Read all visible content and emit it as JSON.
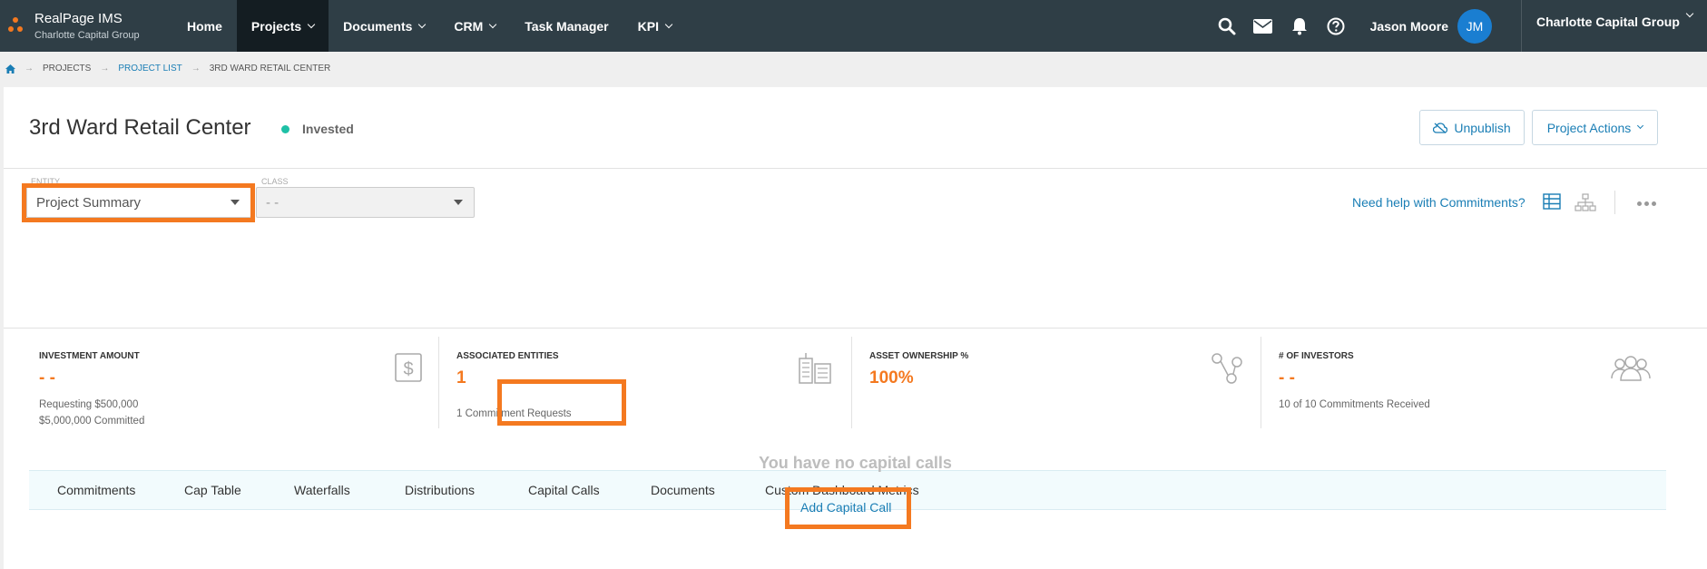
{
  "brand": {
    "title": "RealPage IMS",
    "subtitle": "Charlotte Capital Group"
  },
  "nav": {
    "items": [
      {
        "label": "Home",
        "active": false,
        "dropdown": false
      },
      {
        "label": "Projects",
        "active": true,
        "dropdown": true
      },
      {
        "label": "Documents",
        "active": false,
        "dropdown": true
      },
      {
        "label": "CRM",
        "active": false,
        "dropdown": true
      },
      {
        "label": "Task Manager",
        "active": false,
        "dropdown": false
      },
      {
        "label": "KPI",
        "active": false,
        "dropdown": true
      }
    ],
    "icons": [
      "search-icon",
      "mail-icon",
      "bell-icon",
      "help-icon"
    ],
    "user_name": "Jason Moore",
    "user_initials": "JM",
    "org": "Charlotte Capital Group"
  },
  "breadcrumb": {
    "home_icon": "home-icon",
    "items": [
      "PROJECTS",
      "PROJECT LIST",
      "3RD WARD RETAIL CENTER"
    ]
  },
  "project": {
    "title": "3rd Ward Retail Center",
    "status": "Invested",
    "status_color": "#1ec0a6",
    "unpublish_label": "Unpublish",
    "actions_label": "Project Actions"
  },
  "filters": {
    "entity_label": "ENTITY",
    "entity_value": "Project Summary",
    "class_label": "CLASS",
    "class_value": "- -",
    "help_text": "Need help with Commitments?"
  },
  "stats": [
    {
      "label": "INVESTMENT AMOUNT",
      "value": "- -",
      "notes": [
        "Requesting $500,000",
        "$5,000,000 Committed"
      ],
      "icon": "dollar-icon"
    },
    {
      "label": "ASSOCIATED ENTITIES",
      "value": "1",
      "notes": [
        "1 Commitment Requests"
      ],
      "icon": "buildings-icon"
    },
    {
      "label": "ASSET OWNERSHIP %",
      "value": "100%",
      "notes": [],
      "icon": "share-nodes-icon"
    },
    {
      "label": "# OF INVESTORS",
      "value": "- -",
      "notes": [
        "10 of 10 Commitments Received"
      ],
      "icon": "users-icon"
    }
  ],
  "tabs": [
    "Commitments",
    "Cap Table",
    "Waterfalls",
    "Distributions",
    "Capital Calls",
    "Documents",
    "Custom Dashboard Metrics"
  ],
  "active_tab": "Capital Calls",
  "empty_state": {
    "message": "You have no capital calls",
    "action_label": "Add Capital Call"
  },
  "colors": {
    "accent": "#f47920",
    "link": "#1a7eb5",
    "navbar": "#2f3e46"
  }
}
